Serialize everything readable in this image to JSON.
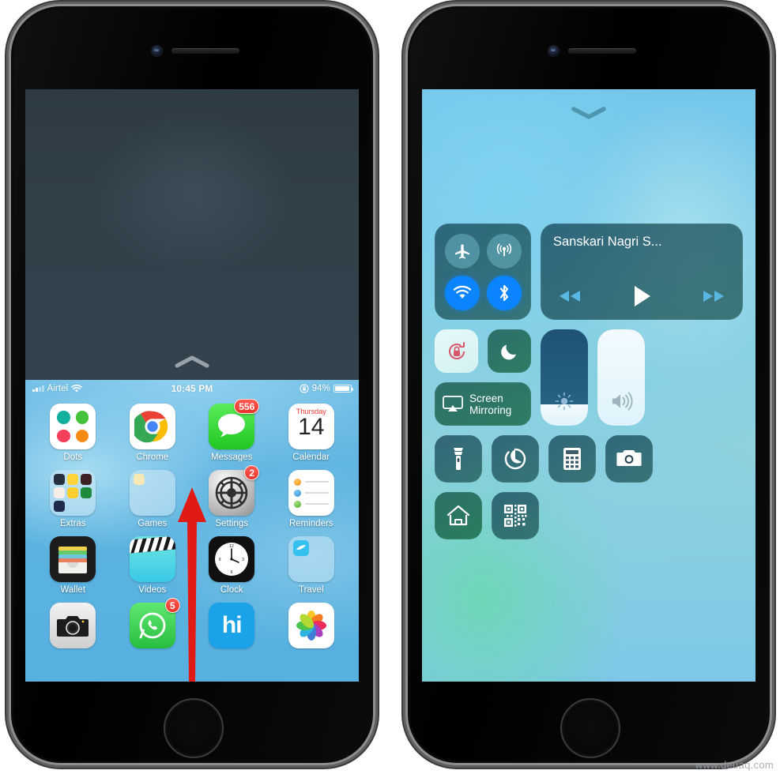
{
  "watermark": "www.deuaq.com",
  "left_phone": {
    "name": "iPhone showing home screen with swipe-up gesture",
    "pull_handle_icon": "chevron-up-icon",
    "status_bar": {
      "carrier": "Airtel",
      "time": "10:45 PM",
      "battery_percent": "94%",
      "signal_icon": "signal-bars-icon",
      "wifi_icon": "wifi-icon",
      "rotation_lock_icon": "rotation-lock-icon",
      "battery_icon": "battery-icon"
    },
    "gesture": {
      "name": "swipe-up-arrow",
      "color": "#e01b16",
      "direction": "up"
    },
    "apps": [
      {
        "label": "Dots",
        "icon": "dots-app-icon",
        "badge": null
      },
      {
        "label": "Chrome",
        "icon": "chrome-app-icon",
        "badge": null
      },
      {
        "label": "Messages",
        "icon": "messages-app-icon",
        "badge": "556"
      },
      {
        "label": "Calendar",
        "icon": "calendar-app-icon",
        "badge": null,
        "weekday": "Thursday",
        "day": "14"
      },
      {
        "label": "Extras",
        "icon": "extras-folder-icon",
        "badge": null
      },
      {
        "label": "Games",
        "icon": "games-folder-icon",
        "badge": null
      },
      {
        "label": "Settings",
        "icon": "settings-app-icon",
        "badge": "2"
      },
      {
        "label": "Reminders",
        "icon": "reminders-app-icon",
        "badge": null
      },
      {
        "label": "Wallet",
        "icon": "wallet-app-icon",
        "badge": null
      },
      {
        "label": "Videos",
        "icon": "videos-app-icon",
        "badge": null
      },
      {
        "label": "Clock",
        "icon": "clock-app-icon",
        "badge": null
      },
      {
        "label": "Travel",
        "icon": "travel-folder-icon",
        "badge": null
      },
      {
        "label": "",
        "icon": "camera-app-icon",
        "badge": null
      },
      {
        "label": "",
        "icon": "whatsapp-app-icon",
        "badge": "5"
      },
      {
        "label": "",
        "icon": "hike-app-icon",
        "badge": null,
        "glyph": "hi"
      },
      {
        "label": "",
        "icon": "photos-app-icon",
        "badge": null
      }
    ]
  },
  "right_phone": {
    "name": "iPhone showing Control Center",
    "handle_icon": "chevron-down-icon",
    "connectivity": {
      "name": "connectivity-tile",
      "buttons": [
        {
          "name": "airplane-mode-toggle",
          "icon": "airplane-icon",
          "state": "off"
        },
        {
          "name": "cellular-data-toggle",
          "icon": "cellular-icon",
          "state": "off"
        },
        {
          "name": "wifi-toggle",
          "icon": "wifi-icon",
          "state": "on"
        },
        {
          "name": "bluetooth-toggle",
          "icon": "bluetooth-icon",
          "state": "on"
        }
      ],
      "accent_on": "#0a84ff"
    },
    "music": {
      "name": "now-playing-tile",
      "title": "Sanskari Nagri S...",
      "controls": [
        {
          "name": "rewind-button",
          "icon": "rewind-icon"
        },
        {
          "name": "play-button",
          "icon": "play-icon"
        },
        {
          "name": "fast-forward-button",
          "icon": "fast-forward-icon"
        }
      ]
    },
    "toggles": [
      {
        "name": "rotation-lock-toggle",
        "icon": "rotation-lock-icon",
        "state": "on"
      },
      {
        "name": "do-not-disturb-toggle",
        "icon": "moon-icon",
        "state": "off"
      }
    ],
    "screen_mirroring": {
      "name": "screen-mirroring-tile",
      "line1": "Screen",
      "line2": "Mirroring",
      "icon": "airplay-icon"
    },
    "brightness": {
      "name": "brightness-slider",
      "icon": "brightness-icon",
      "level_percent": 22
    },
    "volume": {
      "name": "volume-slider",
      "icon": "speaker-icon",
      "level_percent": 100
    },
    "shortcuts": [
      {
        "name": "flashlight-shortcut",
        "icon": "flashlight-icon"
      },
      {
        "name": "timer-shortcut",
        "icon": "timer-icon"
      },
      {
        "name": "calculator-shortcut",
        "icon": "calculator-icon"
      },
      {
        "name": "camera-shortcut",
        "icon": "camera-icon"
      },
      {
        "name": "home-shortcut",
        "icon": "house-icon"
      },
      {
        "name": "qr-scanner-shortcut",
        "icon": "qr-code-icon"
      }
    ]
  }
}
